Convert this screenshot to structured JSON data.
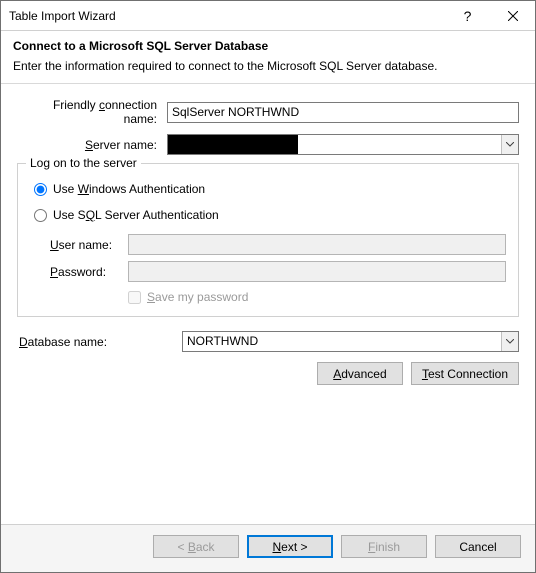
{
  "window": {
    "title": "Table Import Wizard"
  },
  "header": {
    "title": "Connect to a Microsoft SQL Server Database",
    "subtitle": "Enter the information required to connect to the Microsoft SQL Server database."
  },
  "fields": {
    "friendly_label_pre": "Friendly ",
    "friendly_label_u": "c",
    "friendly_label_post": "onnection name:",
    "friendly_value": "SqlServer NORTHWND",
    "server_label_pre": "",
    "server_label_u": "S",
    "server_label_post": "erver name:",
    "server_value": ""
  },
  "logon": {
    "legend": "Log on to the server",
    "windows_pre": "Use ",
    "windows_u": "W",
    "windows_post": "indows Authentication",
    "sql_pre": "Use S",
    "sql_u": "Q",
    "sql_post": "L Server Authentication",
    "user_label_u": "U",
    "user_label_post": "ser name:",
    "user_value": "",
    "pass_label_u": "P",
    "pass_label_post": "assword:",
    "pass_value": "",
    "save_pre": "",
    "save_u": "S",
    "save_post": "ave my password"
  },
  "database": {
    "label_u": "D",
    "label_post": "atabase name:",
    "value": "NORTHWND"
  },
  "buttons": {
    "advanced_u": "A",
    "advanced_post": "dvanced",
    "test_u": "T",
    "test_post": "est Connection",
    "back_pre": "< ",
    "back_u": "B",
    "back_post": "ack",
    "next_u": "N",
    "next_post": "ext >",
    "finish_u": "F",
    "finish_post": "inish",
    "cancel": "Cancel"
  }
}
